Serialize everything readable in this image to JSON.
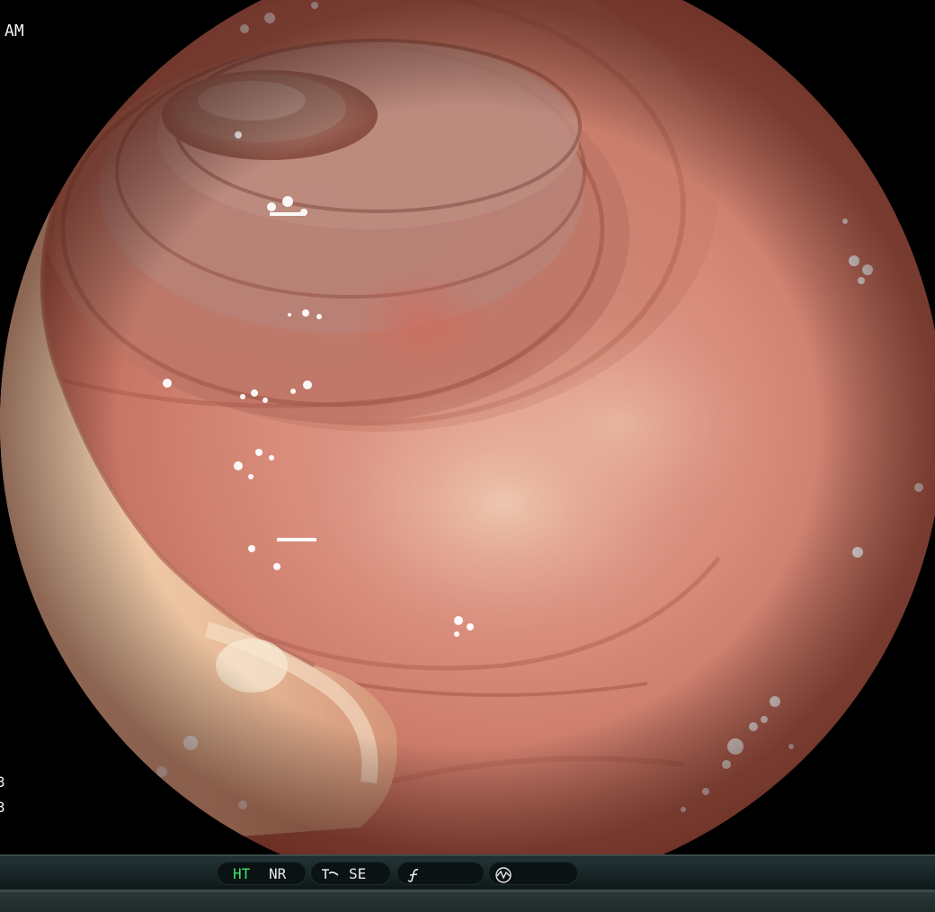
{
  "overlay": {
    "top_left": "AM",
    "left_num_1": "3",
    "left_num_2": "3"
  },
  "statusbar": {
    "mode_1": "HT",
    "mode_2": "NR",
    "mode_3": "SE",
    "icon_1": "enhancement-curve-icon",
    "icon_2": "function-icon",
    "icon_3": "waveform-icon",
    "active_color": "#3fe36a"
  }
}
